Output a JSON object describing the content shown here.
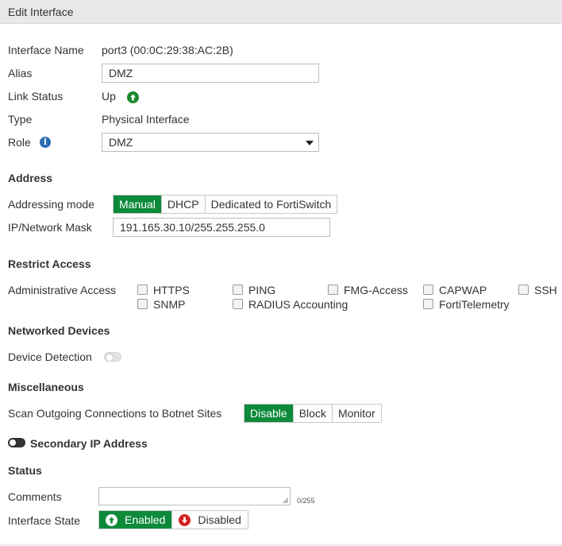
{
  "window": {
    "title": "Edit Interface"
  },
  "general": {
    "interface_name_label": "Interface Name",
    "interface_name_value": "port3 (00:0C:29:38:AC:2B)",
    "alias_label": "Alias",
    "alias_value": "DMZ",
    "link_status_label": "Link Status",
    "link_status_value": "Up",
    "type_label": "Type",
    "type_value": "Physical Interface",
    "role_label": "Role",
    "role_value": "DMZ"
  },
  "address": {
    "section_title": "Address",
    "addressing_mode_label": "Addressing mode",
    "modes": [
      "Manual",
      "DHCP",
      "Dedicated to FortiSwitch"
    ],
    "selected_mode": "Manual",
    "ip_mask_label": "IP/Network Mask",
    "ip_mask_value": "191.165.30.10/255.255.255.0"
  },
  "restrict_access": {
    "section_title": "Restrict Access",
    "admin_access_label": "Administrative Access",
    "options": [
      {
        "label": "HTTPS",
        "checked": false
      },
      {
        "label": "PING",
        "checked": false
      },
      {
        "label": "FMG-Access",
        "checked": false
      },
      {
        "label": "CAPWAP",
        "checked": false
      },
      {
        "label": "SSH",
        "checked": false
      },
      {
        "label": "SNMP",
        "checked": false
      },
      {
        "label": "RADIUS Accounting",
        "checked": false
      },
      {
        "label": "FortiTelemetry",
        "checked": false
      }
    ]
  },
  "networked_devices": {
    "section_title": "Networked Devices",
    "device_detection_label": "Device Detection",
    "device_detection_enabled": false
  },
  "miscellaneous": {
    "section_title": "Miscellaneous",
    "botnet_label": "Scan Outgoing Connections to Botnet Sites",
    "botnet_options": [
      "Disable",
      "Block",
      "Monitor"
    ],
    "botnet_selected": "Disable"
  },
  "secondary_ip": {
    "label": "Secondary IP Address",
    "enabled": false
  },
  "status": {
    "section_title": "Status",
    "comments_label": "Comments",
    "comments_value": "",
    "comments_counter": "0/255",
    "interface_state_label": "Interface State",
    "state_enabled_label": "Enabled",
    "state_disabled_label": "Disabled",
    "state_selected": "Enabled"
  },
  "colors": {
    "accent_green": "#0d8a3a",
    "disabled_red": "#d42121",
    "info_blue": "#2a6db5",
    "titlebar_bg": "#e9e9e9"
  },
  "icons": {
    "link_up": "up-arrow-circle-icon",
    "role_info": "info-icon",
    "enabled": "up-arrow-circle-icon",
    "disabled": "down-arrow-circle-icon",
    "role_dropdown": "caret-down-icon"
  }
}
